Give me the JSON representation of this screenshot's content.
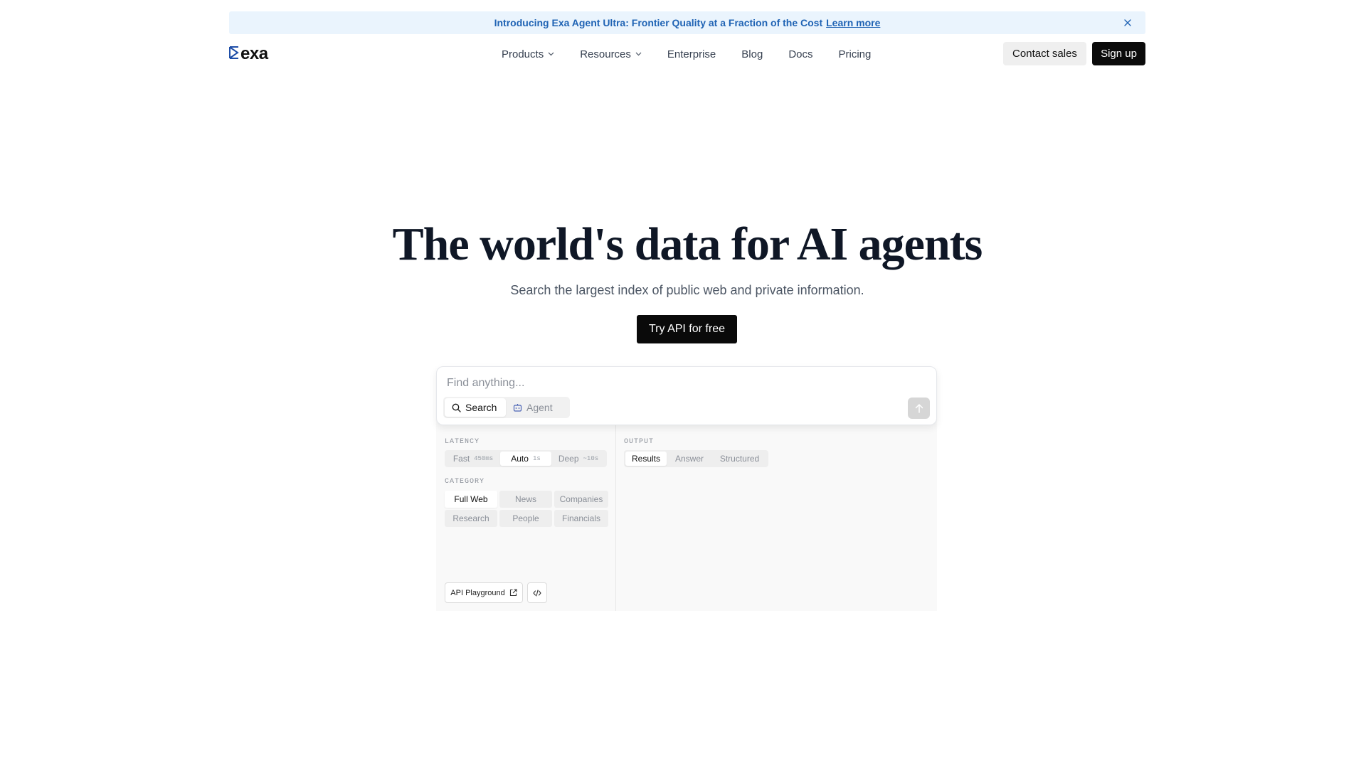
{
  "banner": {
    "text": "Introducing Exa Agent Ultra: Frontier Quality at a Fraction of the Cost",
    "link": "Learn more",
    "close_icon": "close-icon"
  },
  "header": {
    "logo_text": "exa",
    "nav": [
      {
        "label": "Products",
        "has_dropdown": true
      },
      {
        "label": "Resources",
        "has_dropdown": true
      },
      {
        "label": "Enterprise"
      },
      {
        "label": "Blog"
      },
      {
        "label": "Docs"
      },
      {
        "label": "Pricing"
      }
    ],
    "contact_label": "Contact sales",
    "signup_label": "Sign up"
  },
  "hero": {
    "title": "The world's data for AI agents",
    "subtitle": "Search the largest index of public web and private information.",
    "cta_label": "Try API for free"
  },
  "search": {
    "placeholder": "Find anything...",
    "modes": [
      {
        "label": "Search",
        "icon": "search-icon",
        "active": true
      },
      {
        "label": "Agent",
        "icon": "robot-icon",
        "active": false
      }
    ],
    "submit_icon": "arrow-up-icon"
  },
  "options": {
    "latency_label": "LATENCY",
    "latency": [
      {
        "label": "Fast",
        "hint": "450ms",
        "active": false
      },
      {
        "label": "Auto",
        "hint": "1s",
        "active": true
      },
      {
        "label": "Deep",
        "hint": "~10s",
        "active": false
      }
    ],
    "category_label": "CATEGORY",
    "categories": [
      {
        "label": "Full Web",
        "active": true
      },
      {
        "label": "News",
        "active": false
      },
      {
        "label": "Companies",
        "active": false
      },
      {
        "label": "Research",
        "active": false
      },
      {
        "label": "People",
        "active": false
      },
      {
        "label": "Financials",
        "active": false
      }
    ],
    "output_label": "OUTPUT",
    "output": [
      {
        "label": "Results",
        "active": true
      },
      {
        "label": "Answer",
        "active": false
      },
      {
        "label": "Structured",
        "active": false
      }
    ],
    "playground_label": "API Playground",
    "code_icon": "code-icon"
  },
  "colors": {
    "banner_bg": "#eaf4fd",
    "banner_text": "#1f63b4",
    "brand_blue": "#1f4fa8",
    "primary": "#0a0a0a"
  }
}
